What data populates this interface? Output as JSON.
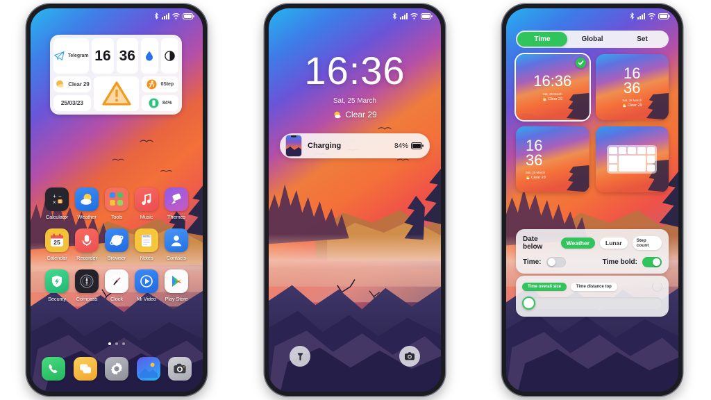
{
  "scene": {
    "background": "#ffffff",
    "phone_count": 3
  },
  "statusbar": {
    "icons": [
      "bluetooth-icon",
      "signal-icon",
      "wifi-icon",
      "battery-icon"
    ]
  },
  "phone1": {
    "name": "home-screen",
    "widget": {
      "telegram_label": "Telegram",
      "hour": "16",
      "minute": "36",
      "humidity_icon": "water-drop-icon",
      "contrast_icon": "contrast-icon",
      "weather_label": "Clear 29",
      "weather_icon": "sun-icon",
      "date_label": "25/03/23",
      "warning_icon": "warning-triangle-icon",
      "step_label": "0Step",
      "step_icon": "walking-icon",
      "battery_label": "84%",
      "battery_icon": "battery-vertical-icon"
    },
    "apps": [
      [
        {
          "label": "Calculator",
          "icon": "calculator-icon"
        },
        {
          "label": "Weather",
          "icon": "weather-icon"
        },
        {
          "label": "Tools",
          "icon": "tools-folder-icon"
        },
        {
          "label": "Music",
          "icon": "music-note-icon"
        },
        {
          "label": "Themes",
          "icon": "themes-icon"
        }
      ],
      [
        {
          "label": "Calendar",
          "icon": "calendar-icon"
        },
        {
          "label": "Recorder",
          "icon": "recorder-icon"
        },
        {
          "label": "Browser",
          "icon": "browser-icon"
        },
        {
          "label": "Notes",
          "icon": "notes-icon"
        },
        {
          "label": "Contacts",
          "icon": "contacts-icon"
        }
      ],
      [
        {
          "label": "Security",
          "icon": "security-shield-icon"
        },
        {
          "label": "Compass",
          "icon": "compass-icon"
        },
        {
          "label": "Clock",
          "icon": "clock-icon"
        },
        {
          "label": "Mi Video",
          "icon": "video-play-icon"
        },
        {
          "label": "Play Store",
          "icon": "play-store-icon"
        }
      ]
    ],
    "page_dots": {
      "count": 3,
      "active_index": 0
    },
    "dock": [
      {
        "name": "phone-app",
        "icon": "phone-handset-icon"
      },
      {
        "name": "messages-app",
        "icon": "messages-icon"
      },
      {
        "name": "settings-app",
        "icon": "gear-icon"
      },
      {
        "name": "gallery-app",
        "icon": "gallery-icon"
      },
      {
        "name": "camera-app",
        "icon": "camera-icon"
      }
    ]
  },
  "phone2": {
    "name": "lock-screen",
    "time": "16:36",
    "date": "Sat, 25 March",
    "weather": "Clear 29",
    "weather_icon": "sun-cloud-icon",
    "notification": {
      "title": "Charging",
      "battery": "84%",
      "thumb": "phone-thumbnail",
      "battery_icon": "battery-icon"
    },
    "shortcuts": [
      {
        "name": "flashlight-shortcut",
        "icon": "flashlight-icon"
      },
      {
        "name": "camera-shortcut",
        "icon": "camera-icon"
      }
    ]
  },
  "phone3": {
    "name": "clock-widget-editor",
    "tabs": [
      {
        "label": "Time",
        "active": true
      },
      {
        "label": "Global",
        "active": false
      },
      {
        "label": "Set",
        "active": false
      }
    ],
    "cards": [
      {
        "name": "style-inline-clock",
        "layout": "inline",
        "time": "16:36",
        "date": "Sat, 25 March",
        "weather": "Clear 29",
        "selected": true
      },
      {
        "name": "style-stacked-clock-a",
        "layout": "stacked",
        "hour": "16",
        "minute": "36",
        "date": "Sat, 25 March",
        "weather": "Clear 29",
        "selected": false
      },
      {
        "name": "style-stacked-clock-b",
        "layout": "stacked",
        "hour": "16",
        "minute": "36",
        "date": "Sat, 25 March",
        "weather": "Clear 29",
        "selected": false
      },
      {
        "name": "style-grid-layout",
        "layout": "grid",
        "selected": false
      }
    ],
    "settings": {
      "date_below_label": "Date below",
      "chip_weather": "Weather",
      "chip_lunar": "Lunar",
      "chip_step": "Step count",
      "time_label": "Time:",
      "time_toggle_on": false,
      "time_bold_label": "Time bold:",
      "time_bold_toggle_on": true
    },
    "sliders": {
      "chip_overall_size": "Time overall size",
      "chip_distance_top": "Time distance top",
      "reset_icon": "reset-icon",
      "value_percent": 0
    },
    "accent_color": "#31c45c"
  }
}
